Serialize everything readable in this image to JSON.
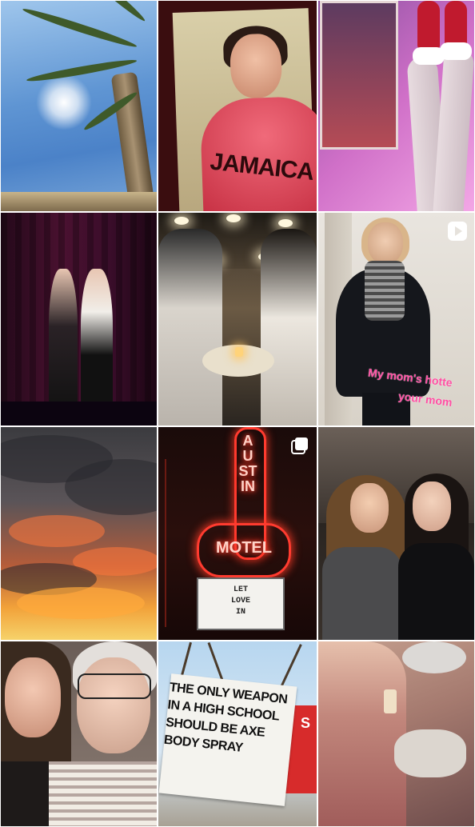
{
  "grid": {
    "tiles": [
      {
        "id": "palm-sky"
      },
      {
        "id": "jamaica-poster",
        "poster_text": "JAMAICA"
      },
      {
        "id": "neon-legs"
      },
      {
        "id": "stage-performers"
      },
      {
        "id": "restaurant"
      },
      {
        "id": "mom-coat",
        "caption_line1": "My mom's hotte",
        "caption_line2": "your mom",
        "overlay_icon": "video-icon"
      },
      {
        "id": "sunset-clouds"
      },
      {
        "id": "austin-motel",
        "sign_vertical": "AUSTIN",
        "sign_main": "MOTEL",
        "marquee_line1": "LET",
        "marquee_line2": "LOVE",
        "marquee_line3": "IN",
        "overlay_icon": "carousel-icon"
      },
      {
        "id": "two-women"
      },
      {
        "id": "selfie-grandma"
      },
      {
        "id": "protest-sign",
        "sign_line1": "THE ONLY WEAPON",
        "sign_line2": "IN A HIGH SCHOOL",
        "sign_line3": "SHOULD BE AXE",
        "sign_line4": "BODY SPRAY",
        "side_sign": "S"
      },
      {
        "id": "crafts"
      }
    ]
  },
  "colors": {
    "caption_pink": "#ff4fa3",
    "neon_red": "#ff3b2f",
    "background": "#ffffff"
  }
}
